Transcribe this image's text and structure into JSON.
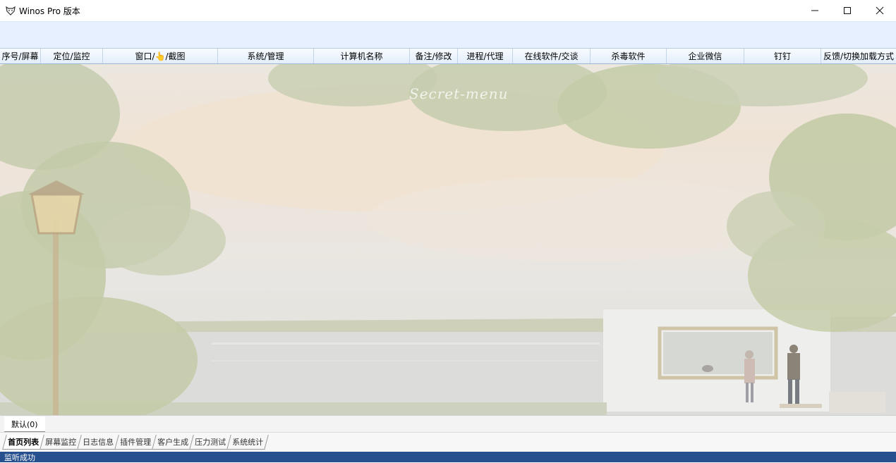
{
  "window": {
    "title": "Winos Pro 版本",
    "icon": "fox-icon",
    "controls": [
      "minimize-icon",
      "maximize-icon",
      "close-icon"
    ]
  },
  "columns": [
    "序号/屏幕",
    "定位/监控",
    "窗口/👆/截图",
    "系统/管理",
    "计算机名称",
    "备注/修改",
    "进程/代理",
    "在线软件/交谈",
    "杀毒软件",
    "企业微信",
    "钉钉",
    "反馈/切换加载方式"
  ],
  "background": {
    "watermark": "Secret-menu"
  },
  "group_tabs": [
    {
      "label": "默认(0)",
      "active": true
    }
  ],
  "function_tabs": [
    {
      "label": "首页列表",
      "active": true
    },
    {
      "label": "屏幕监控",
      "active": false
    },
    {
      "label": "日志信息",
      "active": false
    },
    {
      "label": "插件管理",
      "active": false
    },
    {
      "label": "客户生成",
      "active": false
    },
    {
      "label": "压力测试",
      "active": false
    },
    {
      "label": "系统统计",
      "active": false
    }
  ],
  "status": {
    "text": "监听成功"
  },
  "colors": {
    "toolbar_bg": "#e6f0fe",
    "statusbar_bg": "#27508f"
  }
}
